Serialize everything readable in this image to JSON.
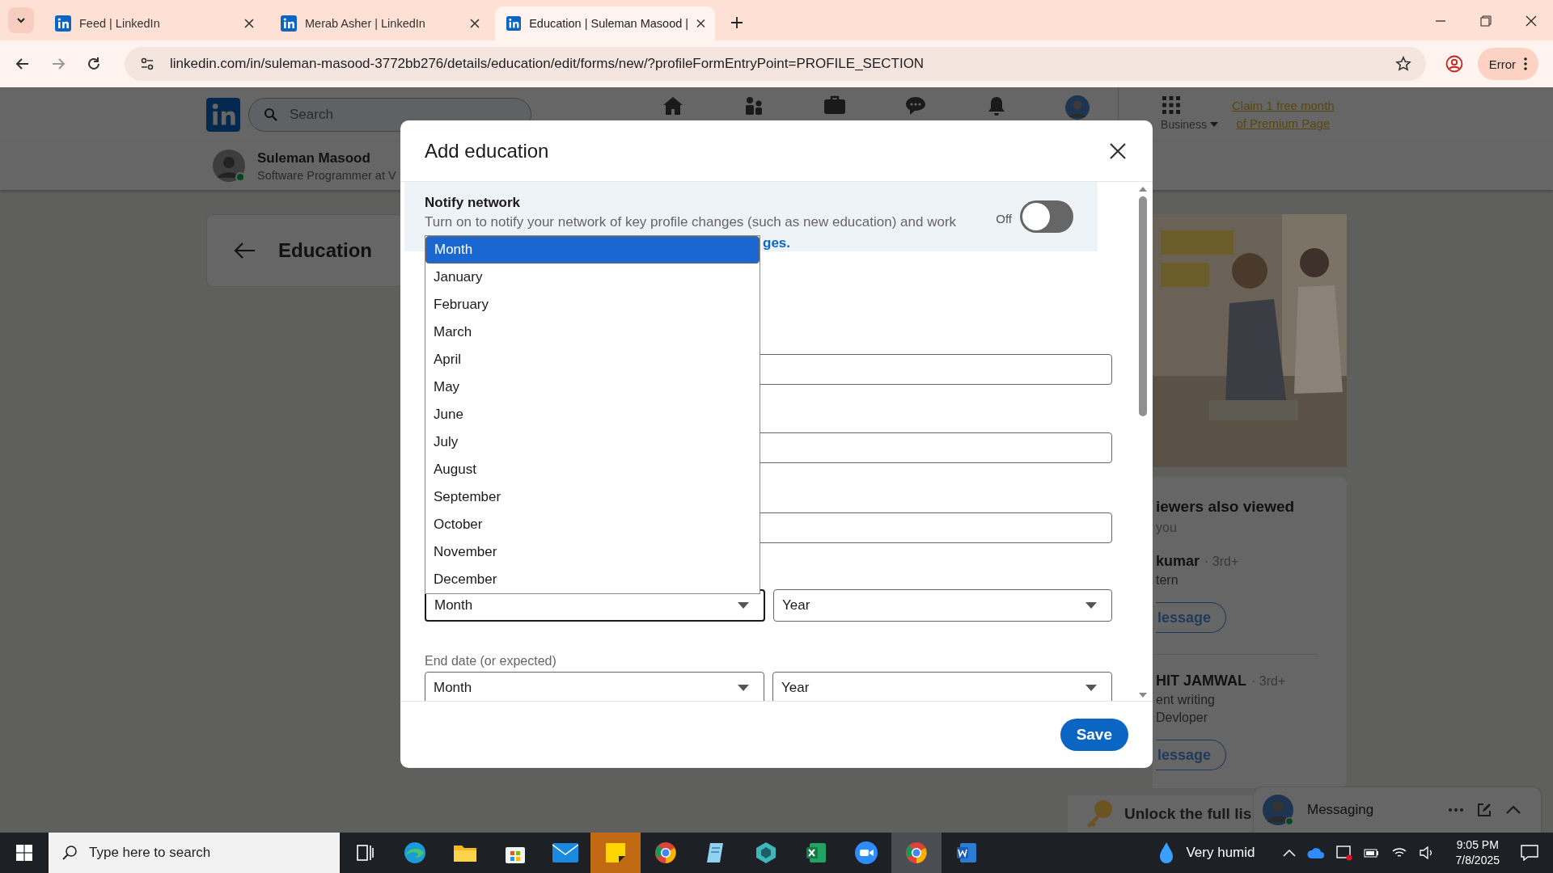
{
  "browser": {
    "tabs": [
      {
        "title": "Feed | LinkedIn",
        "selected": false
      },
      {
        "title": "Merab Asher | LinkedIn",
        "selected": false
      },
      {
        "title": "Education | Suleman Masood |",
        "selected": true
      }
    ],
    "address": "linkedin.com/in/suleman-masood-3772bb276/details/education/edit/forms/new/?profileFormEntryPoint=PROFILE_SECTION",
    "profile_button": "Error"
  },
  "page": {
    "nav": {
      "search_placeholder": "Search",
      "business": "Business",
      "premium": [
        "Claim 1 free month",
        "of Premium Page"
      ]
    },
    "profile": {
      "name": "Suleman Masood",
      "headline": "Software Programmer at V"
    },
    "section_title": "Education",
    "sidebar": {
      "heading": "iewers also viewed",
      "subheading": "you",
      "people": [
        {
          "name": "kumar",
          "degree": "· 3rd+",
          "lines": [
            "tern"
          ],
          "button": "lessage"
        },
        {
          "name": "HIT JAMWAL",
          "degree": "· 3rd+",
          "lines": [
            "ent writing",
            "Devloper"
          ],
          "button": "lessage"
        }
      ]
    },
    "upsell": "Unlock the full lis",
    "messaging": "Messaging"
  },
  "modal": {
    "title": "Add education",
    "notify": {
      "title": "Notify network",
      "description": "Turn on to notify your network of key profile changes (such as new education) and work",
      "link": "ges.",
      "state_label": "Off",
      "on": false
    },
    "start_date": {
      "month": "Month",
      "year": "Year"
    },
    "end_date": {
      "label": "End date (or expected)",
      "month": "Month",
      "year": "Year"
    },
    "dropdown": [
      {
        "label": "Month",
        "selected": true
      },
      {
        "label": "January",
        "selected": false
      },
      {
        "label": "February",
        "selected": false
      },
      {
        "label": "March",
        "selected": false
      },
      {
        "label": "April",
        "selected": false
      },
      {
        "label": "May",
        "selected": false
      },
      {
        "label": "June",
        "selected": false
      },
      {
        "label": "July",
        "selected": false
      },
      {
        "label": "August",
        "selected": false
      },
      {
        "label": "September",
        "selected": false
      },
      {
        "label": "October",
        "selected": false
      },
      {
        "label": "November",
        "selected": false
      },
      {
        "label": "December",
        "selected": false
      }
    ],
    "save": "Save"
  },
  "taskbar": {
    "search_placeholder": "Type here to search",
    "apps": [
      {
        "kind": "taskview",
        "active": false,
        "flashing": false
      },
      {
        "kind": "edge",
        "active": false,
        "flashing": false
      },
      {
        "kind": "explorer",
        "active": false,
        "flashing": false
      },
      {
        "kind": "store",
        "active": false,
        "flashing": false
      },
      {
        "kind": "mail",
        "active": false,
        "flashing": false
      },
      {
        "kind": "sticky",
        "active": false,
        "flashing": true
      },
      {
        "kind": "chrome",
        "active": false,
        "flashing": false
      },
      {
        "kind": "notes",
        "active": false,
        "flashing": false
      },
      {
        "kind": "diamond",
        "active": false,
        "flashing": false
      },
      {
        "kind": "excel",
        "active": false,
        "flashing": false
      },
      {
        "kind": "zoom",
        "active": false,
        "flashing": false
      },
      {
        "kind": "chrome",
        "active": true,
        "flashing": false
      },
      {
        "kind": "word",
        "active": false,
        "flashing": false
      }
    ],
    "weather": "Very humid",
    "time": "9:05 PM",
    "date": "7/8/2025"
  }
}
